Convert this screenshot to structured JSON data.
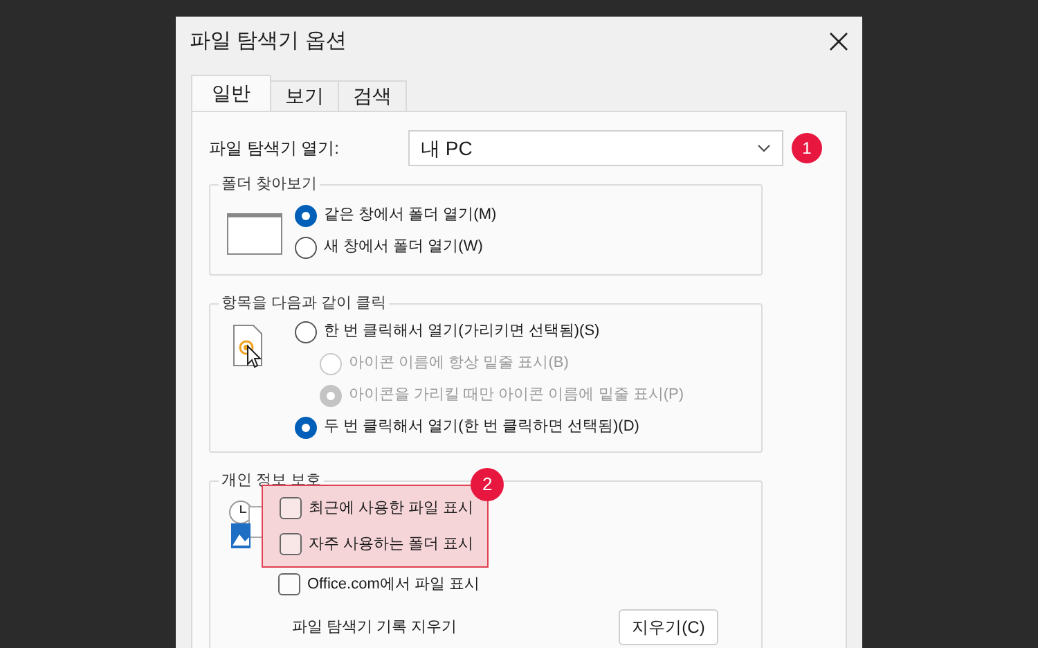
{
  "window": {
    "title": "파일 탐색기 옵션"
  },
  "tabs": [
    {
      "label": "일반",
      "selected": true
    },
    {
      "label": "보기",
      "selected": false
    },
    {
      "label": "검색",
      "selected": false
    }
  ],
  "open_explorer": {
    "label": "파일 탐색기 열기:",
    "value": "내 PC",
    "annotation": "1"
  },
  "browse_folders": {
    "legend": "폴더 찾아보기",
    "options": [
      {
        "label": "같은 창에서 폴더 열기(M)",
        "selected": true,
        "disabled": false
      },
      {
        "label": "새 창에서 폴더 열기(W)",
        "selected": false,
        "disabled": false
      }
    ]
  },
  "click_items": {
    "legend": "항목을 다음과 같이 클릭",
    "options": [
      {
        "label": "한 번 클릭해서 열기(가리키면 선택됨)(S)",
        "selected": false,
        "disabled": false,
        "children": [
          {
            "label": "아이콘 이름에 항상 밑줄 표시(B)",
            "selected": false,
            "disabled": true
          },
          {
            "label": "아이콘을 가리킬 때만 아이콘 이름에 밑줄 표시(P)",
            "selected": true,
            "disabled": true
          }
        ]
      },
      {
        "label": "두 번 클릭해서 열기(한 번 클릭하면 선택됨)(D)",
        "selected": true,
        "disabled": false
      }
    ]
  },
  "privacy": {
    "legend": "개인 정보 보호",
    "annotation": "2",
    "checkboxes": [
      {
        "label": "최근에 사용한 파일 표시",
        "checked": false,
        "highlighted": true
      },
      {
        "label": "자주 사용하는 폴더 표시",
        "checked": false,
        "highlighted": true
      },
      {
        "label": "Office.com에서 파일 표시",
        "checked": false,
        "highlighted": false
      }
    ],
    "clear_label": "파일 탐색기 기록 지우기",
    "clear_button": "지우기(C)"
  }
}
